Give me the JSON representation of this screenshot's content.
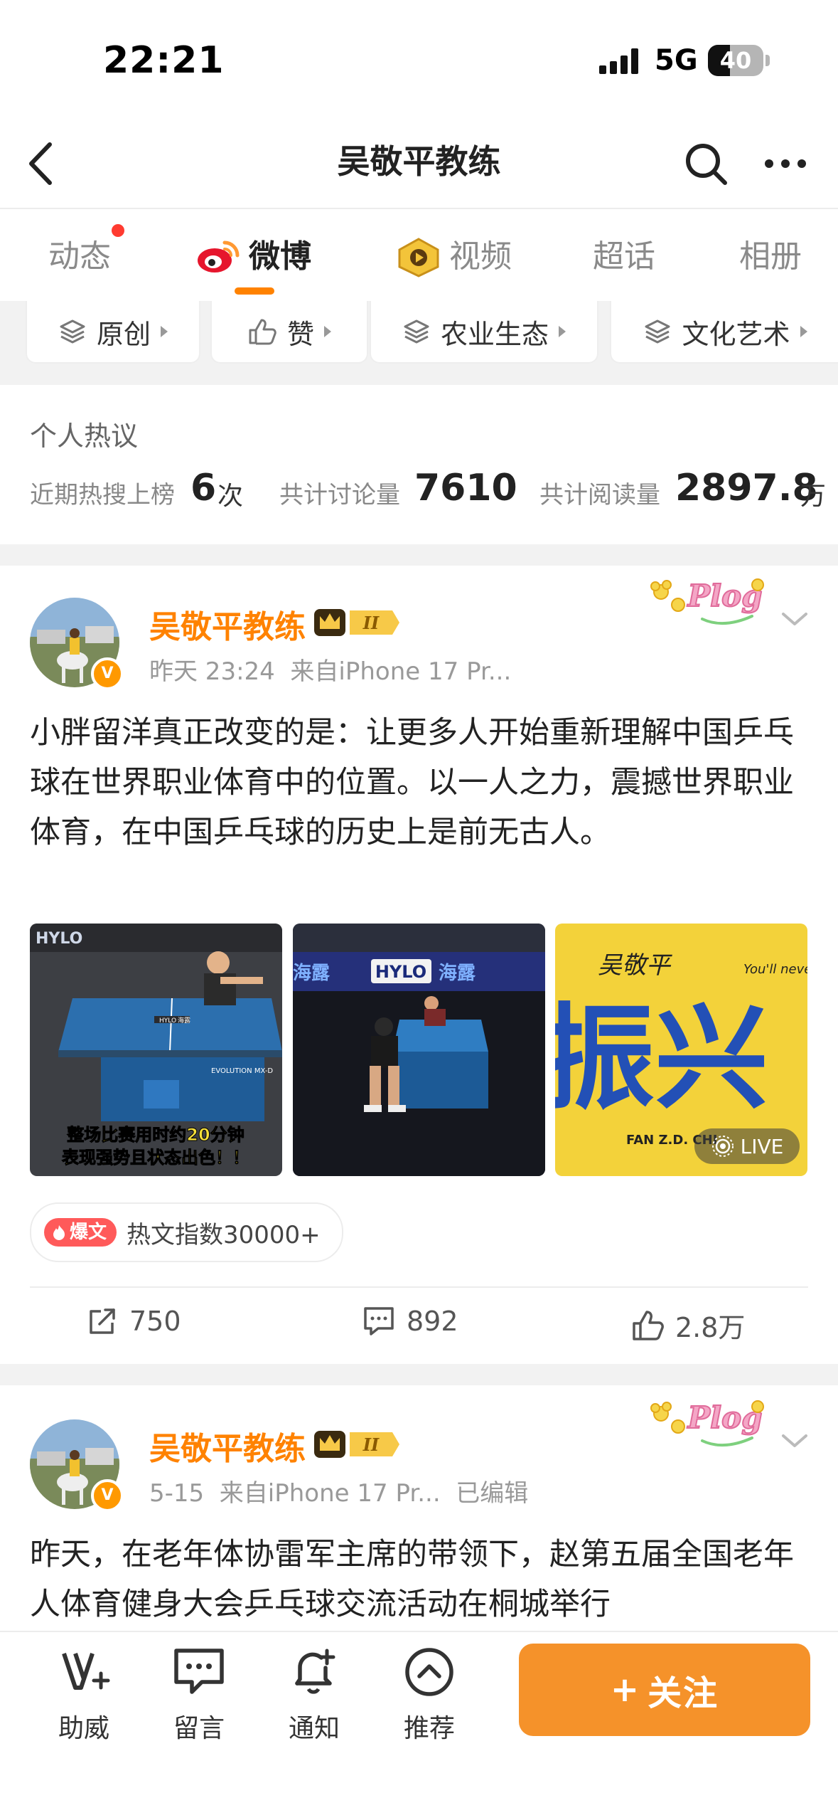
{
  "status_bar": {
    "time": "22:21",
    "network": "5G",
    "battery": "40",
    "battery_level": 0.4
  },
  "nav": {
    "title": "吴敬平教练"
  },
  "tabs": [
    {
      "label": "动态",
      "has_dot": true
    },
    {
      "label": "微博",
      "active": true,
      "icon": "weibo-logo-icon"
    },
    {
      "label": "视频",
      "icon": "video-icon"
    },
    {
      "label": "超话"
    },
    {
      "label": "相册"
    }
  ],
  "filters": [
    {
      "label": "原创",
      "icon": "layers-icon"
    },
    {
      "label": "赞",
      "icon": "thumbs-up-icon"
    },
    {
      "label": "农业生态",
      "icon": "layers-icon"
    },
    {
      "label": "文化艺术",
      "icon": "layers-icon"
    }
  ],
  "hot_stats": {
    "title": "个人热议",
    "trending_label": "近期热搜上榜",
    "trending_value": "6",
    "trending_unit": "次",
    "discuss_label": "共计讨论量",
    "discuss_value": "7610",
    "read_label": "共计阅读量",
    "read_value": "2897.8",
    "read_unit": "万"
  },
  "posts": [
    {
      "author": "吴敬平教练",
      "badge_level": "II",
      "time": "昨天 23:24",
      "source": "来自iPhone 17 Pr...",
      "edited": "",
      "text": "小胖留洋真正改变的是：让更多人开始重新理解中国乒乓球在世界职业体育中的位置。以一人之力，震撼世界职业体育，在中国乒乓球的历史上是前无古人。",
      "images": [
        {
          "caption_1": "整场比赛用时约20分钟",
          "caption_2": "表现强势且状态出色！！",
          "sign_1": "HYLO",
          "sign_2": "海露",
          "sign_3": "EVOLUTION MX-D"
        },
        {
          "sign_1": "海露",
          "sign_2": "HYLO",
          "sign_3": "海露"
        },
        {
          "big_text": "振兴",
          "signature": "吴敬平",
          "sub_text": "You'll never",
          "bottom_text": "FAN Z.D. CHI",
          "live_label": "LIVE"
        }
      ],
      "hot_badge": {
        "tag": "爆文",
        "label": "热文指数30000+"
      },
      "actions": {
        "reposts": "750",
        "comments": "892",
        "likes": "2.8万"
      }
    },
    {
      "author": "吴敬平教练",
      "badge_level": "II",
      "time": "5-15",
      "source": "来自iPhone 17 Pr...",
      "edited": "已编辑",
      "text": "昨天，在老年体协雷军主席的带领下，赵第五届全国老年人体育健身大会乒乓球交流活动在桐城举行"
    }
  ],
  "plog_label": "Plog",
  "bottom_bar": {
    "items": [
      {
        "label": "助威",
        "icon": "cheer-icon"
      },
      {
        "label": "留言",
        "icon": "message-icon"
      },
      {
        "label": "通知",
        "icon": "bell-plus-icon"
      },
      {
        "label": "推荐",
        "icon": "recommend-up-icon"
      }
    ],
    "follow": {
      "plus": "+",
      "label": "关注"
    }
  },
  "colors": {
    "accent": "#ff8200",
    "follow_button": "#f5922a",
    "hot_red": "#ff5a5a"
  }
}
